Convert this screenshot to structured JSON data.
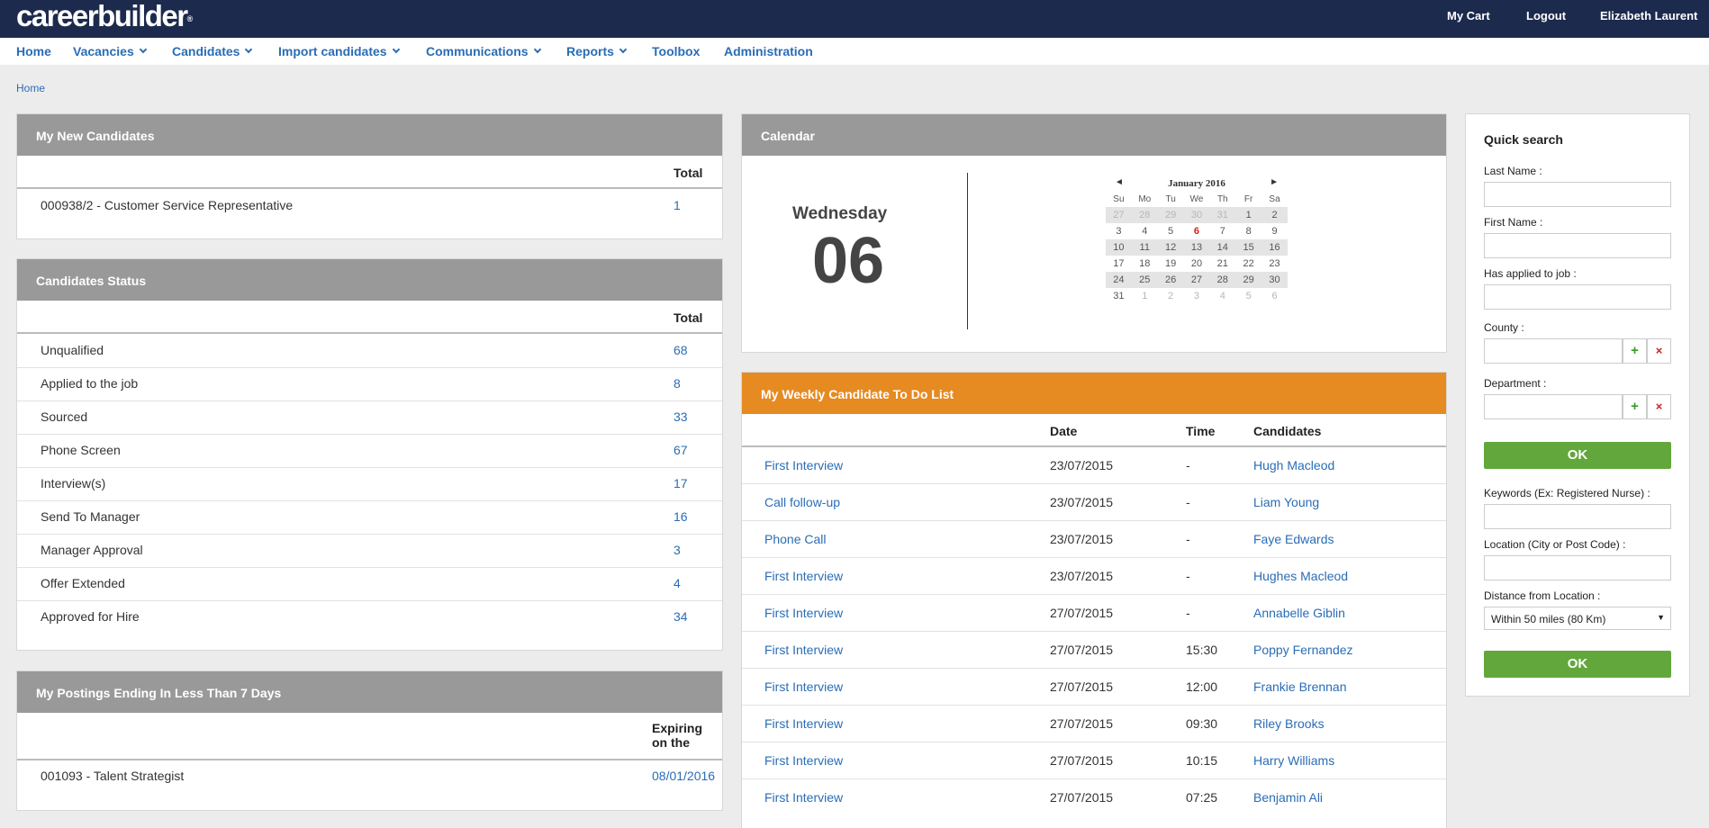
{
  "brand": {
    "logo": "careerbuilder",
    "logo_mark": "®"
  },
  "top_links": {
    "cart": "My Cart",
    "logout": "Logout",
    "user": "Elizabeth Laurent"
  },
  "nav": [
    {
      "label": "Home"
    },
    {
      "label": "Vacancies"
    },
    {
      "label": "Candidates"
    },
    {
      "label": "Import candidates"
    },
    {
      "label": "Communications"
    },
    {
      "label": "Reports"
    },
    {
      "label": "Toolbox"
    },
    {
      "label": "Administration"
    }
  ],
  "breadcrumb": "Home",
  "new_candidates": {
    "title": "My New Candidates",
    "total_header": "Total",
    "rows": [
      {
        "label": "000938/2 - Customer Service Representative",
        "value": "1"
      }
    ]
  },
  "status": {
    "title": "Candidates Status",
    "total_header": "Total",
    "rows": [
      {
        "label": "Unqualified",
        "value": "68"
      },
      {
        "label": "Applied to the job",
        "value": "8"
      },
      {
        "label": "Sourced",
        "value": "33"
      },
      {
        "label": "Phone Screen",
        "value": "67"
      },
      {
        "label": "Interview(s)",
        "value": "17"
      },
      {
        "label": "Send To Manager",
        "value": "16"
      },
      {
        "label": "Manager Approval",
        "value": "3"
      },
      {
        "label": "Offer Extended",
        "value": "4"
      },
      {
        "label": "Approved for Hire",
        "value": "34"
      }
    ]
  },
  "postings": {
    "title": "My Postings Ending In Less Than 7 Days",
    "header_line1": "Expiring",
    "header_line2": "on the",
    "rows": [
      {
        "label": "001093 - Talent Strategist",
        "value": "08/01/2016"
      }
    ]
  },
  "calendar": {
    "title": "Calendar",
    "weekday": "Wednesday",
    "day": "06",
    "month_title": "January 2016",
    "prev": "◄",
    "next": "►",
    "weekday_headers": [
      "Su",
      "Mo",
      "Tu",
      "We",
      "Th",
      "Fr",
      "Sa"
    ],
    "weeks": [
      [
        "27",
        "28",
        "29",
        "30",
        "31",
        "1",
        "2"
      ],
      [
        "3",
        "4",
        "5",
        "6",
        "7",
        "8",
        "9"
      ],
      [
        "10",
        "11",
        "12",
        "13",
        "14",
        "15",
        "16"
      ],
      [
        "17",
        "18",
        "19",
        "20",
        "21",
        "22",
        "23"
      ],
      [
        "24",
        "25",
        "26",
        "27",
        "28",
        "29",
        "30"
      ],
      [
        "31",
        "1",
        "2",
        "3",
        "4",
        "5",
        "6"
      ]
    ]
  },
  "todo": {
    "title": "My Weekly Candidate To Do List",
    "headers": {
      "date": "Date",
      "time": "Time",
      "candidates": "Candidates"
    },
    "rows": [
      {
        "task": "First Interview",
        "date": "23/07/2015",
        "time": "-",
        "candidate": "Hugh Macleod"
      },
      {
        "task": "Call follow-up",
        "date": "23/07/2015",
        "time": "-",
        "candidate": "Liam Young"
      },
      {
        "task": "Phone Call",
        "date": "23/07/2015",
        "time": "-",
        "candidate": "Faye Edwards"
      },
      {
        "task": "First Interview",
        "date": "23/07/2015",
        "time": "-",
        "candidate": "Hughes Macleod"
      },
      {
        "task": "First Interview",
        "date": "27/07/2015",
        "time": "-",
        "candidate": "Annabelle Giblin"
      },
      {
        "task": "First Interview",
        "date": "27/07/2015",
        "time": "15:30",
        "candidate": "Poppy Fernandez"
      },
      {
        "task": "First Interview",
        "date": "27/07/2015",
        "time": "12:00",
        "candidate": "Frankie Brennan"
      },
      {
        "task": "First Interview",
        "date": "27/07/2015",
        "time": "09:30",
        "candidate": "Riley Brooks"
      },
      {
        "task": "First Interview",
        "date": "27/07/2015",
        "time": "10:15",
        "candidate": "Harry Williams"
      },
      {
        "task": "First Interview",
        "date": "27/07/2015",
        "time": "07:25",
        "candidate": "Benjamin Ali"
      }
    ]
  },
  "quick_search": {
    "title": "Quick search",
    "last_name_label": "Last Name :",
    "first_name_label": "First Name :",
    "applied_label": "Has applied to job :",
    "county_label": "County :",
    "department_label": "Department :",
    "add_symbol": "+",
    "remove_symbol": "×",
    "ok_label": "OK",
    "keywords_label": "Keywords (Ex: Registered Nurse) :",
    "location_label": "Location (City or Post Code) :",
    "distance_label": "Distance from Location :",
    "distance_value": "Within 50 miles (80 Km)",
    "select_arrow": "▼",
    "ok2_label": "OK"
  },
  "colors": {
    "topbar": "#1c2a4d",
    "link": "#2a6db5",
    "panel_header": "#999999",
    "todo_header": "#e68a22",
    "ok_button": "#62a73b"
  }
}
